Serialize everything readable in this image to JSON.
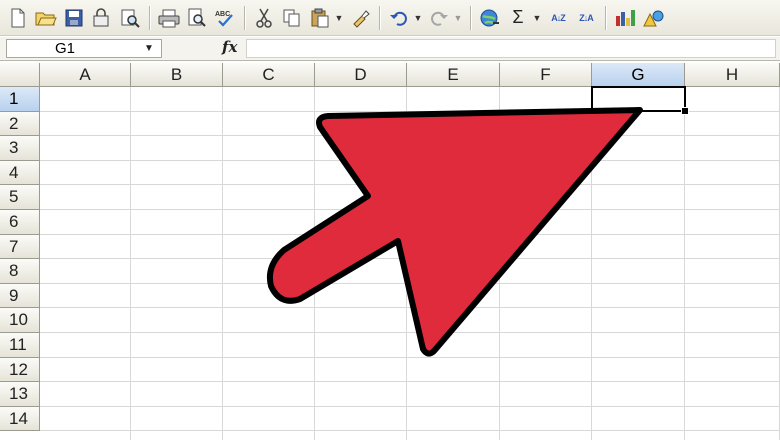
{
  "toolbar": {
    "icons": [
      "new-icon",
      "open-icon",
      "save-icon",
      "permission-icon",
      "research-icon",
      "print-icon",
      "print-preview-icon",
      "spelling-icon",
      "cut-icon",
      "copy-icon",
      "paste-icon",
      "format-painter-icon",
      "undo-icon",
      "redo-icon",
      "hyperlink-icon",
      "autosum-icon",
      "sort-ascending-icon",
      "sort-descending-icon",
      "chart-wizard-icon",
      "drawing-icon"
    ],
    "autosum_glyph": "Σ",
    "sort_asc_glyph": "A↓Z",
    "sort_desc_glyph": "Z↓A",
    "spelling_glyph": "ABC"
  },
  "formula_bar": {
    "name_box": "G1",
    "fx_label": "fx",
    "formula": ""
  },
  "columns": [
    "A",
    "B",
    "C",
    "D",
    "E",
    "F",
    "G",
    "H"
  ],
  "rows": [
    "1",
    "2",
    "3",
    "4",
    "5",
    "6",
    "7",
    "8",
    "9",
    "10",
    "11",
    "12",
    "13",
    "14"
  ],
  "selection": {
    "cell": "G1",
    "column": "G",
    "row": "1"
  },
  "annotation": {
    "type": "pointer-arrow",
    "fill": "#e02b3c",
    "stroke": "#000000"
  },
  "colors": {
    "selected_header": "#b8d1ee",
    "toolbar_bg": "#ece9d8",
    "grid_line": "#d8d8d8"
  }
}
